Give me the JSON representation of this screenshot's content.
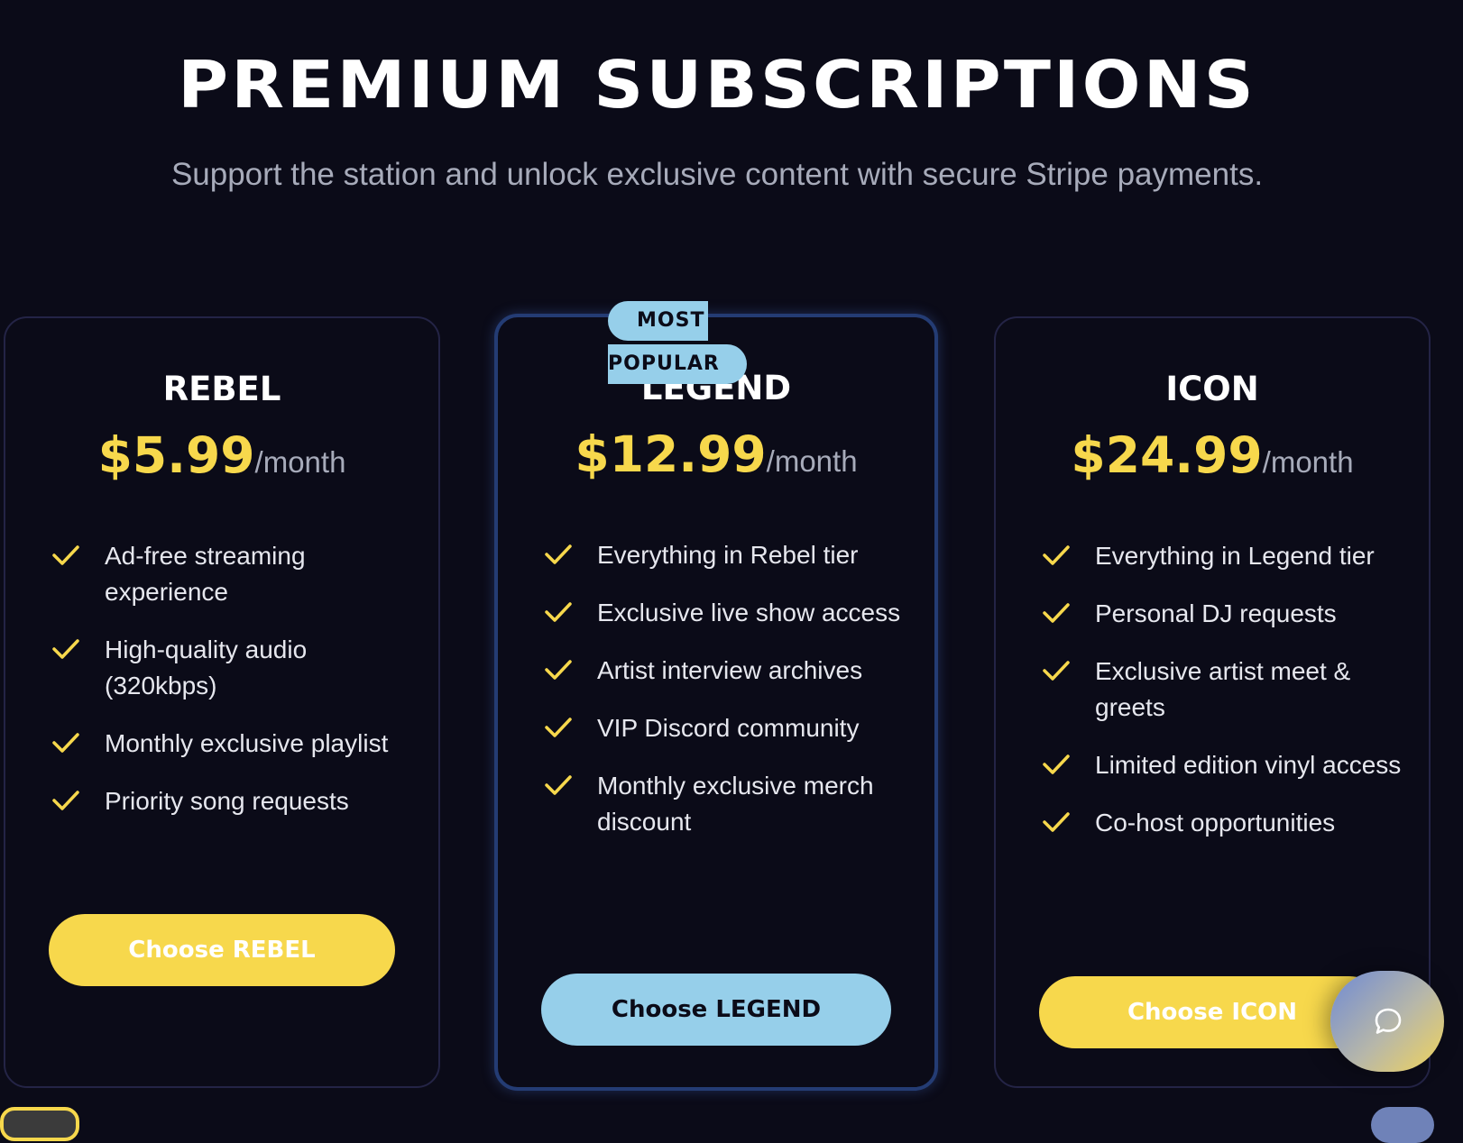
{
  "hero": {
    "title": "PREMIUM SUBSCRIPTIONS",
    "subtitle": "Support the station and unlock exclusive content with secure Stripe payments."
  },
  "badge": {
    "line1": "MOST",
    "line2": "POPULAR"
  },
  "plans": [
    {
      "name": "REBEL",
      "price": "$5.99",
      "period": "/month",
      "features": [
        "Ad-free streaming experience",
        "High-quality audio (320kbps)",
        "Monthly exclusive playlist",
        "Priority song requests"
      ],
      "cta": "Choose REBEL"
    },
    {
      "name": "LEGEND",
      "price": "$12.99",
      "period": "/month",
      "features": [
        "Everything in Rebel tier",
        "Exclusive live show access",
        "Artist interview archives",
        "VIP Discord community",
        "Monthly exclusive merch discount"
      ],
      "cta": "Choose LEGEND"
    },
    {
      "name": "ICON",
      "price": "$24.99",
      "period": "/month",
      "features": [
        "Everything in Legend tier",
        "Personal DJ requests",
        "Exclusive artist meet & greets",
        "Limited edition vinyl access",
        "Co-host opportunities"
      ],
      "cta": "Choose ICON"
    }
  ],
  "colors": {
    "background": "#0b0b18",
    "accent_yellow": "#f7d84c",
    "accent_blue": "#96cfea",
    "muted_text": "#a7abba"
  },
  "icons": {
    "feature": "check-icon",
    "chat": "chat-bubble-icon"
  }
}
